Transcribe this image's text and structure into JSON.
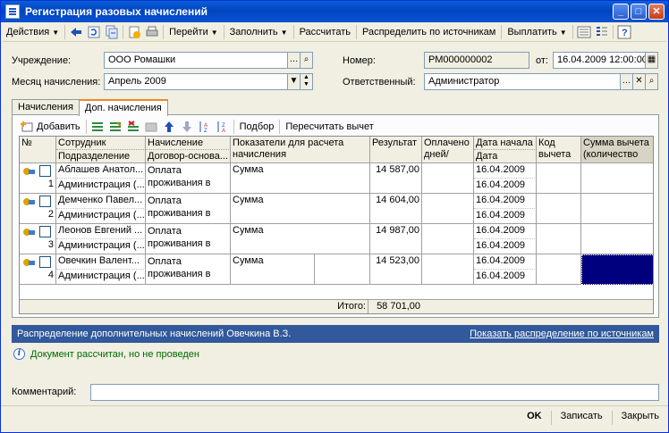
{
  "window": {
    "title": "Регистрация разовых начислений"
  },
  "toolbar": {
    "actions": "Действия",
    "goto": "Перейти",
    "fill": "Заполнить",
    "calc": "Рассчитать",
    "distribute": "Распределить по источникам",
    "pay": "Выплатить"
  },
  "form": {
    "org_label": "Учреждение:",
    "org_value": "ООО Ромашки",
    "month_label": "Месяц начисления:",
    "month_value": "Апрель 2009",
    "number_label": "Номер:",
    "number_value": "РМ000000002",
    "from_label": "от:",
    "date_value": "16.04.2009 12:00:00",
    "resp_label": "Ответственный:",
    "resp_value": "Администратор"
  },
  "tabs": [
    "Начисления",
    "Доп. начисления"
  ],
  "grid_toolbar": {
    "add": "Добавить",
    "select": "Подбор",
    "recalc": "Пересчитать вычет"
  },
  "grid": {
    "headers": {
      "num": "№",
      "employee": "Сотрудник",
      "department": "Подразделение",
      "accrual": "Начисление",
      "contract": "Договор-основа...",
      "indicators": "Показатели для расчета начисления",
      "result": "Результат",
      "paid": "Оплачено дней/час...",
      "date_start": "Дата начала",
      "date_end": "Дата оконч...",
      "code": "Код вычета",
      "sum_ded": "Сумма вычета (количество"
    },
    "rows": [
      {
        "n": "1",
        "employee": "Аблашев Анатол...",
        "department": "Администрация (...",
        "accrual": "Оплата проживания в",
        "indicator": "Сумма",
        "result": "14 587,00",
        "start": "16.04.2009",
        "end": "16.04.2009"
      },
      {
        "n": "2",
        "employee": "Демченко Павел...",
        "department": "Администрация (...",
        "accrual": "Оплата проживания в",
        "indicator": "Сумма",
        "result": "14 604,00",
        "start": "16.04.2009",
        "end": "16.04.2009"
      },
      {
        "n": "3",
        "employee": "Леонов Евгений ...",
        "department": "Администрация (...",
        "accrual": "Оплата проживания в",
        "indicator": "Сумма",
        "result": "14 987,00",
        "start": "16.04.2009",
        "end": "16.04.2009"
      },
      {
        "n": "4",
        "employee": "Овечкин Валент...",
        "department": "Администрация (...",
        "accrual": "Оплата проживания в",
        "indicator": "Сумма",
        "result": "14 523,00",
        "start": "16.04.2009",
        "end": "16.04.2009"
      }
    ],
    "total_label": "Итого:",
    "total_value": "58 701,00"
  },
  "distribution_bar": {
    "text": "Распределение дополнительных начислений Овечкина В.З.",
    "link": "Показать распределение по источникам"
  },
  "status": {
    "text": "Документ рассчитан, но не проведен"
  },
  "comment": {
    "label": "Комментарий:",
    "value": ""
  },
  "buttons": {
    "ok": "OK",
    "save": "Записать",
    "close": "Закрыть"
  }
}
